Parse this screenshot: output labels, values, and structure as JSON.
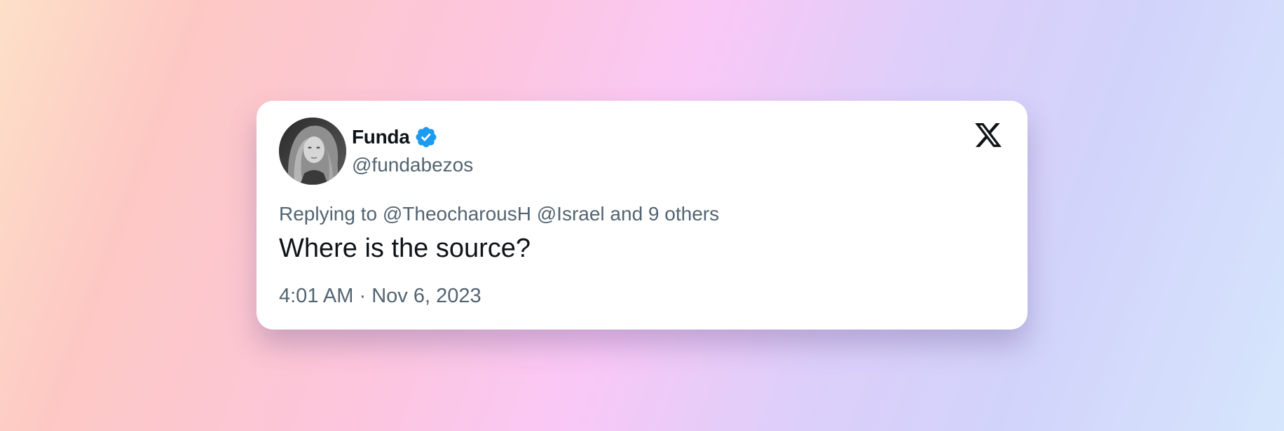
{
  "tweet": {
    "author": {
      "name": "Funda",
      "handle": "@fundabezos",
      "verified": true,
      "avatar_icon": "profile-photo"
    },
    "brand_icon": "x-logo-icon",
    "replying_prefix": "Replying to",
    "replying_to": [
      "@TheocharousH",
      "@Israel"
    ],
    "replying_suffix": "and 9 others",
    "text": "Where is the source?",
    "time": "4:01 AM",
    "separator": "·",
    "date": "Nov 6, 2023"
  },
  "colors": {
    "verified_badge": "#1d9bf0",
    "primary_text": "#0f1419",
    "secondary_text": "#536471",
    "card_background": "#ffffff"
  }
}
